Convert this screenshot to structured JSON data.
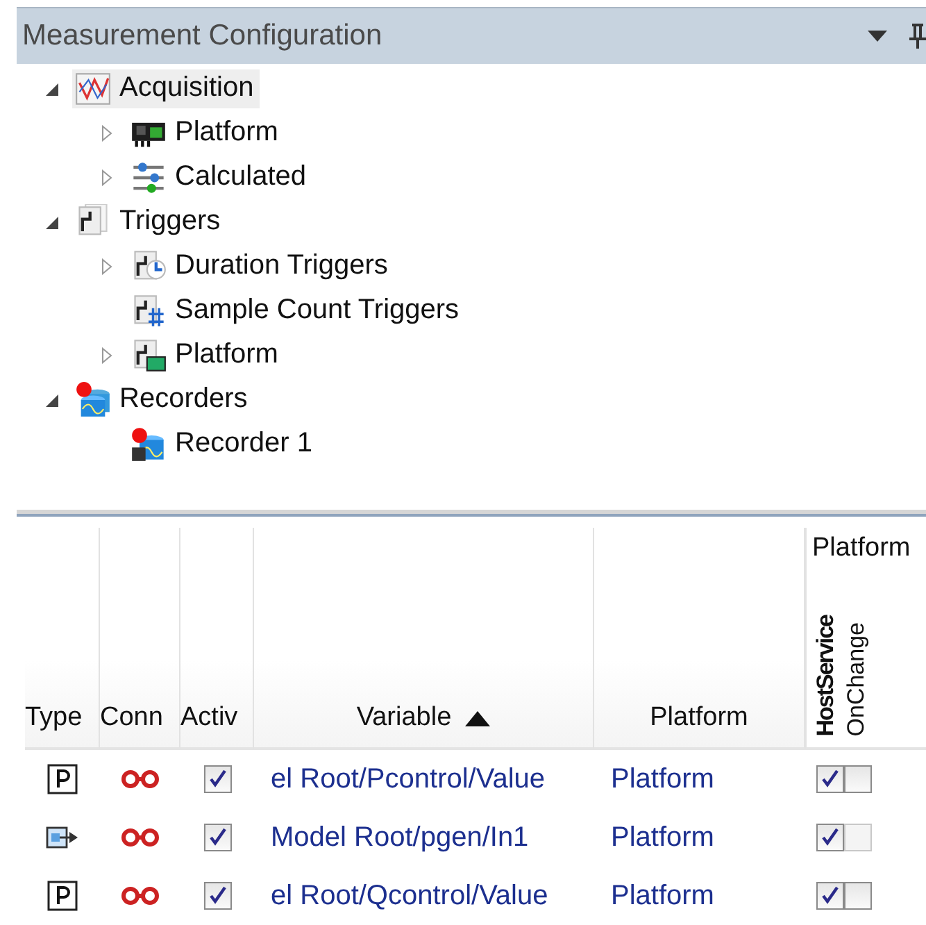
{
  "panel": {
    "title": "Measurement Configuration"
  },
  "tree": [
    {
      "label": "Acquisition",
      "kind": "acquisition",
      "expanded": true,
      "selected": true,
      "children": [
        {
          "label": "Platform",
          "kind": "board",
          "expanded": false,
          "selected": false
        },
        {
          "label": "Calculated",
          "kind": "sliders",
          "expanded": false,
          "selected": false
        }
      ]
    },
    {
      "label": "Triggers",
      "kind": "trigger",
      "expanded": true,
      "selected": false,
      "children": [
        {
          "label": "Duration Triggers",
          "kind": "trigger-clock",
          "expanded": false,
          "selected": false
        },
        {
          "label": "Sample Count Triggers",
          "kind": "trigger-hash",
          "selected": false
        },
        {
          "label": "Platform",
          "kind": "trigger-board",
          "expanded": false,
          "selected": false
        }
      ]
    },
    {
      "label": "Recorders",
      "kind": "recorders",
      "expanded": true,
      "selected": false,
      "children": [
        {
          "label": "Recorder 1",
          "kind": "recorder",
          "selected": false
        }
      ]
    }
  ],
  "table": {
    "columns": [
      {
        "label": "Type",
        "sorted": false
      },
      {
        "label": "Conn",
        "sorted": false
      },
      {
        "label": "Activ",
        "sorted": false
      },
      {
        "label": "Variable",
        "sorted": true
      },
      {
        "label": "Platform",
        "sorted": false
      }
    ],
    "group": {
      "label": "Platform",
      "subcolumns": [
        "HostService",
        "OnChange"
      ]
    },
    "rows": [
      {
        "kind": "parameter",
        "connected": true,
        "active": true,
        "variable": "el Root/Pcontrol/Value",
        "platform": "Platform",
        "host_service": {
          "checked": true,
          "disabled": false
        },
        "on_change": {
          "checked": false,
          "disabled": false
        }
      },
      {
        "kind": "inport",
        "connected": true,
        "active": true,
        "variable": "Model Root/pgen/In1",
        "platform": "Platform",
        "host_service": {
          "checked": true,
          "disabled": false
        },
        "on_change": {
          "checked": false,
          "disabled": true
        }
      },
      {
        "kind": "parameter",
        "connected": true,
        "active": true,
        "variable": "el Root/Qcontrol/Value",
        "platform": "Platform",
        "host_service": {
          "checked": true,
          "disabled": false
        },
        "on_change": {
          "checked": false,
          "disabled": false
        }
      }
    ]
  }
}
